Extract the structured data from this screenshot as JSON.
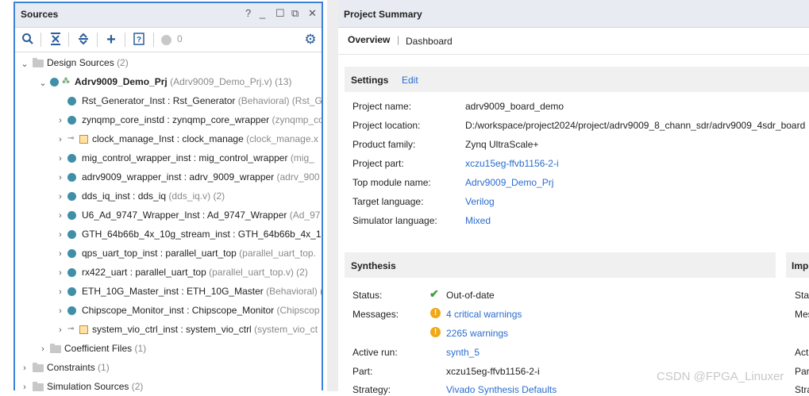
{
  "sources": {
    "title": "Sources",
    "toolbar": {
      "count": "0"
    },
    "tree": {
      "design_sources": {
        "label": "Design Sources",
        "count": "(2)"
      },
      "top": {
        "label": "Adrv9009_Demo_Prj",
        "file": "(Adrv9009_Demo_Prj.v) (13)"
      },
      "items": [
        {
          "name": "Rst_Generator_Inst : Rst_Generator",
          "suffix": "(Behavioral) (Rst_G"
        },
        {
          "name": "zynqmp_core_instd : zynqmp_core_wrapper",
          "suffix": "(zynqmp_co"
        },
        {
          "name": "clock_manage_Inst : clock_manage",
          "suffix": "(clock_manage.x"
        },
        {
          "name": "mig_control_wrapper_inst : mig_control_wrapper",
          "suffix": "(mig_"
        },
        {
          "name": "adrv9009_wrapper_inst : adrv_9009_wrapper",
          "suffix": "(adrv_900"
        },
        {
          "name": "dds_iq_inst : dds_iq",
          "suffix": "(dds_iq.v) (2)"
        },
        {
          "name": "U6_Ad_9747_Wrapper_Inst : Ad_9747_Wrapper",
          "suffix": "(Ad_97"
        },
        {
          "name": "GTH_64b66b_4x_10g_stream_inst : GTH_64b66b_4x_1",
          "suffix": ""
        },
        {
          "name": "qps_uart_top_inst : parallel_uart_top",
          "suffix": "(parallel_uart_top."
        },
        {
          "name": "rx422_uart : parallel_uart_top",
          "suffix": "(parallel_uart_top.v) (2)"
        },
        {
          "name": "ETH_10G_Master_inst : ETH_10G_Master",
          "suffix": "(Behavioral) ("
        },
        {
          "name": "Chipscope_Monitor_inst : Chipscope_Monitor",
          "suffix": "(Chipscop"
        },
        {
          "name": "system_vio_ctrl_inst : system_vio_ctrl",
          "suffix": "(system_vio_ct"
        }
      ],
      "coefficient": {
        "label": "Coefficient Files",
        "count": "(1)"
      },
      "constraints": {
        "label": "Constraints",
        "count": "(1)"
      },
      "simulation": {
        "label": "Simulation Sources",
        "count": "(2)"
      }
    }
  },
  "summary": {
    "title": "Project Summary",
    "tabs": [
      "Overview",
      "Dashboard"
    ],
    "settings": {
      "title": "Settings",
      "edit": "Edit",
      "rows": [
        {
          "label": "Project name:",
          "value": "adrv9009_board_demo"
        },
        {
          "label": "Project location:",
          "value": "D:/workspace/project2024/project/adrv9009_8_chann_sdr/adrv9009_4sdr_board"
        },
        {
          "label": "Product family:",
          "value": "Zynq UltraScale+"
        },
        {
          "label": "Project part:",
          "value": "xczu15eg-ffvb1156-2-i"
        },
        {
          "label": "Top module name:",
          "value": "Adrv9009_Demo_Prj"
        },
        {
          "label": "Target language:",
          "value": "Verilog"
        },
        {
          "label": "Simulator language:",
          "value": "Mixed"
        }
      ]
    },
    "synthesis": {
      "title": "Synthesis",
      "status_label": "Status:",
      "status": "Out-of-date",
      "messages_label": "Messages:",
      "critical": "4 critical warnings",
      "warnings": "2265 warnings",
      "active_run_label": "Active run:",
      "active_run": "synth_5",
      "part_label": "Part:",
      "part": "xczu15eg-ffvb1156-2-i",
      "strategy_label": "Strategy:",
      "strategy": "Vivado Synthesis Defaults"
    },
    "implementation": {
      "title": "Imp",
      "labels": [
        "Sta",
        "Mes",
        "Acti",
        "Par",
        "Stra"
      ]
    }
  },
  "watermark": "CSDN @FPGA_Linuxer"
}
